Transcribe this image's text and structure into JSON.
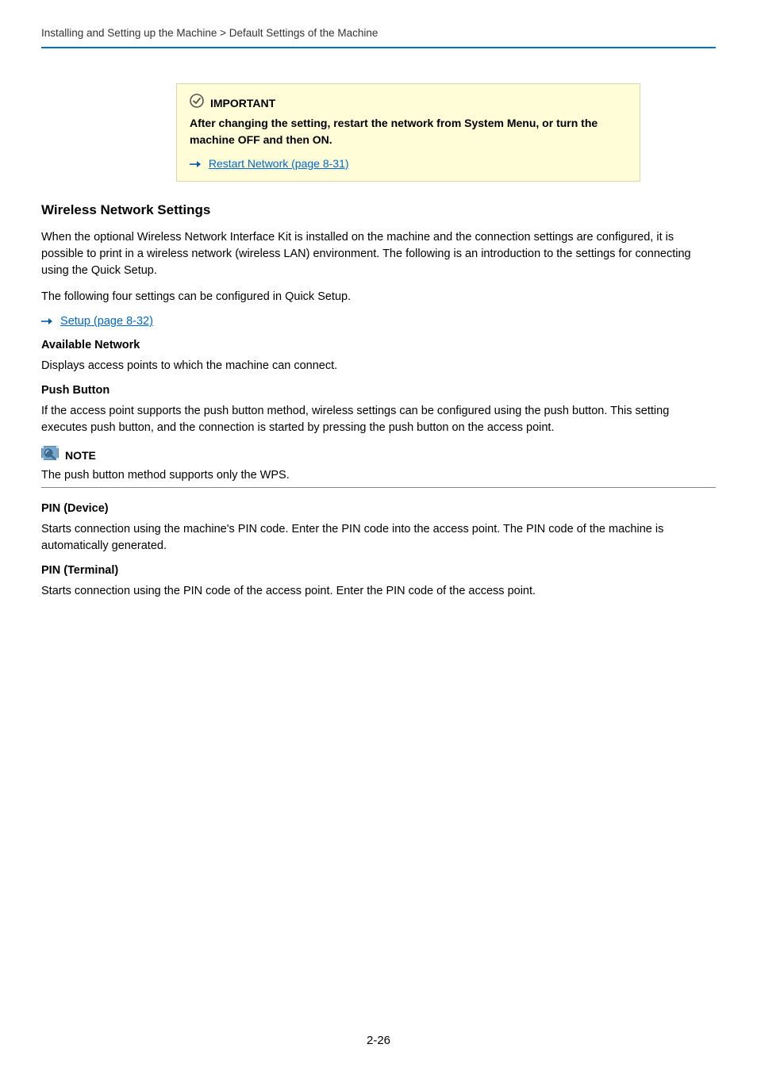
{
  "breadcrumb": "Installing and Setting up the Machine > Default Settings of the Machine",
  "important": {
    "label": "IMPORTANT",
    "text": "After changing the setting, restart the network from System Menu, or turn the machine OFF and then ON.",
    "link": "Restart Network (page 8-31)"
  },
  "section_title": "Wireless Network Settings",
  "intro_p1": "When the optional Wireless Network Interface Kit is installed on the machine and the connection settings are configured, it is possible to print in a wireless network (wireless LAN) environment. The following is an introduction to the settings for connecting using the Quick Setup.",
  "intro_p2": "The following four settings can be configured in Quick Setup.",
  "setup_link": "Setup (page 8-32)",
  "available_network": {
    "heading": "Available Network",
    "text": "Displays access points to which the machine can connect."
  },
  "push_button": {
    "heading": "Push Button",
    "text": "If the access point supports the push button method, wireless settings can be configured using the push button. This setting executes push button, and the connection is started by pressing the push button on the access point."
  },
  "note": {
    "label": "NOTE",
    "text": "The push button method supports only the WPS."
  },
  "pin_device": {
    "heading": "PIN (Device)",
    "text": "Starts connection using the machine's PIN code. Enter the PIN code into the access point. The PIN code of the machine is automatically generated."
  },
  "pin_terminal": {
    "heading": "PIN (Terminal)",
    "text": "Starts connection using the PIN code of the access point. Enter the PIN code of the access point."
  },
  "page_number": "2-26"
}
